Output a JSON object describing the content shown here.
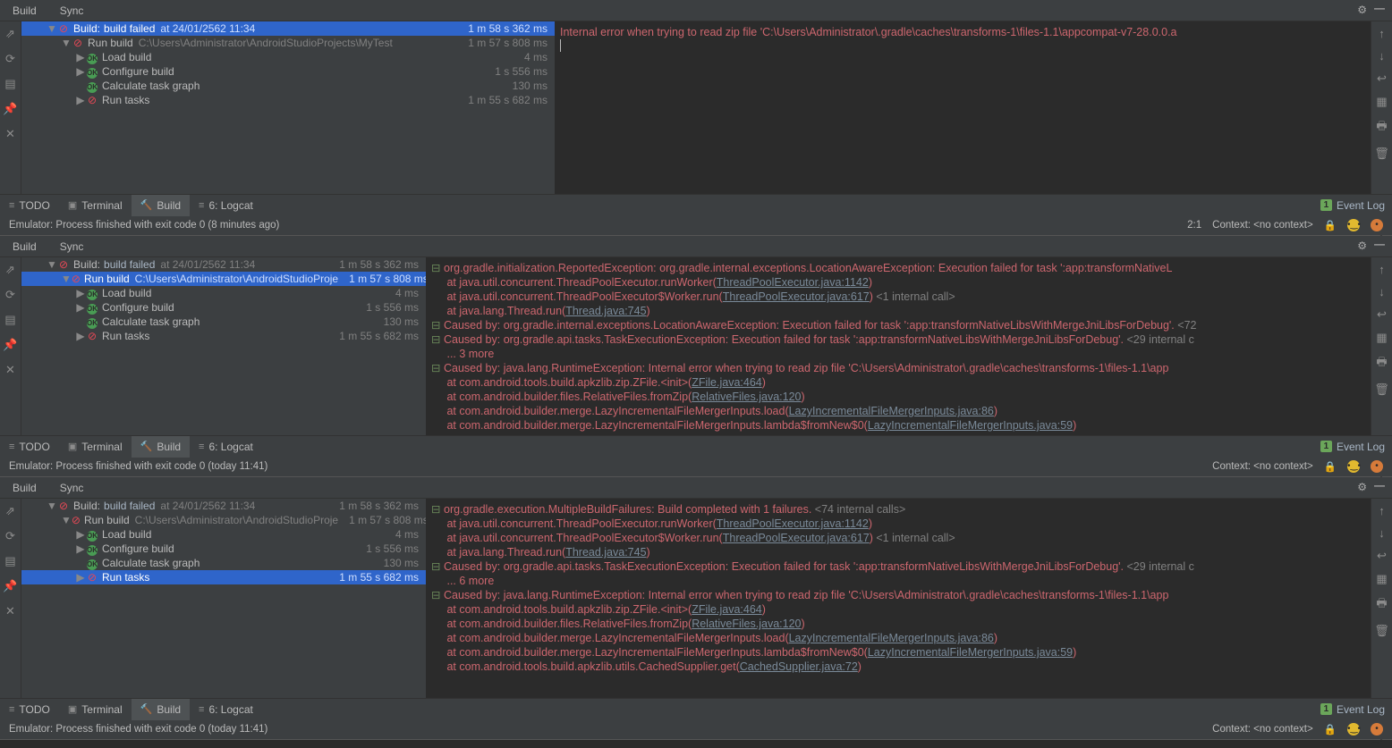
{
  "pane1": {
    "tabs": {
      "build": "Build",
      "sync": "Sync"
    },
    "tree": [
      {
        "indent": 28,
        "arrow": "▼",
        "ico": "err",
        "label": "Build:",
        "suffix": "build failed",
        "dim": "at 24/01/2562 11:34",
        "time": "1 m 58 s 362 ms",
        "sel": true
      },
      {
        "indent": 44,
        "arrow": "▼",
        "ico": "err",
        "label": "Run build",
        "dim": "C:\\Users\\Administrator\\AndroidStudioProjects\\MyTest",
        "time": "1 m 57 s 808 ms"
      },
      {
        "indent": 60,
        "arrow": "▶",
        "ico": "ok",
        "label": "Load build",
        "time": "4 ms"
      },
      {
        "indent": 60,
        "arrow": "▶",
        "ico": "ok",
        "label": "Configure build",
        "time": "1 s 556 ms"
      },
      {
        "indent": 60,
        "arrow": "",
        "ico": "ok",
        "label": "Calculate task graph",
        "time": "130 ms"
      },
      {
        "indent": 60,
        "arrow": "▶",
        "ico": "err",
        "label": "Run tasks",
        "time": "1 m 55 s 682 ms"
      }
    ],
    "treeWidth": 596,
    "console": [
      "Internal error when trying to read zip file 'C:\\Users\\Administrator\\.gradle\\caches\\transforms-1\\files-1.1\\appcompat-v7-28.0.0.a"
    ],
    "status": "Emulator: Process finished with exit code 0 (8 minutes ago)",
    "statusRight": [
      "2:1",
      "Context: <no context>"
    ]
  },
  "pane2": {
    "tabs": {
      "build": "Build",
      "sync": "Sync"
    },
    "tree": [
      {
        "indent": 28,
        "arrow": "▼",
        "ico": "err",
        "label": "Build:",
        "suffix": "build failed",
        "dim": "at 24/01/2562 11:34",
        "time": "1 m 58 s 362 ms"
      },
      {
        "indent": 44,
        "arrow": "▼",
        "ico": "err",
        "label": "Run build",
        "dim": "C:\\Users\\Administrator\\AndroidStudioProje",
        "time": "1 m 57 s 808 ms",
        "sel": true
      },
      {
        "indent": 60,
        "arrow": "▶",
        "ico": "ok",
        "label": "Load build",
        "time": "4 ms"
      },
      {
        "indent": 60,
        "arrow": "▶",
        "ico": "ok",
        "label": "Configure build",
        "time": "1 s 556 ms"
      },
      {
        "indent": 60,
        "arrow": "",
        "ico": "ok",
        "label": "Calculate task graph",
        "time": "130 ms"
      },
      {
        "indent": 60,
        "arrow": "▶",
        "ico": "err",
        "label": "Run tasks",
        "time": "1 m 55 s 682 ms"
      }
    ],
    "treeWidth": 452,
    "console": [
      {
        "fold": "⊟",
        "cls": "red-txt",
        "text": "org.gradle.initialization.ReportedException: org.gradle.internal.exceptions.LocationAwareException: Execution failed for task ':app:transformNativeL"
      },
      {
        "cls": "red-txt",
        "text": "      at java.util.concurrent.ThreadPoolExecutor.runWorker(",
        "link": "ThreadPoolExecutor.java:1142",
        "after": ")"
      },
      {
        "cls": "red-txt",
        "text": "      at java.util.concurrent.ThreadPoolExecutor$Worker.run(",
        "link": "ThreadPoolExecutor.java:617",
        "after": ") ",
        "gray": "<1 internal call>"
      },
      {
        "cls": "red-txt",
        "text": "      at java.lang.Thread.run(",
        "link": "Thread.java:745",
        "after": ")"
      },
      {
        "fold": "⊟",
        "cls": "red-txt",
        "text": "Caused by: org.gradle.internal.exceptions.LocationAwareException: Execution failed for task ':app:transformNativeLibsWithMergeJniLibsForDebug'. ",
        "gray": "<72"
      },
      {
        "fold": "⊟",
        "cls": "red-txt",
        "text": "Caused by: org.gradle.api.tasks.TaskExecutionException: Execution failed for task ':app:transformNativeLibsWithMergeJniLibsForDebug'. ",
        "gray": "<29 internal c"
      },
      {
        "cls": "red-txt",
        "text": "      ... 3 more"
      },
      {
        "fold": "⊟",
        "cls": "red-txt",
        "text": "Caused by: java.lang.RuntimeException: Internal error when trying to read zip file 'C:\\Users\\Administrator\\.gradle\\caches\\transforms-1\\files-1.1\\app"
      },
      {
        "cls": "red-txt",
        "text": "      at com.android.tools.build.apkzlib.zip.ZFile.<init>(",
        "link": "ZFile.java:464",
        "after": ")"
      },
      {
        "cls": "red-txt",
        "text": "      at com.android.builder.files.RelativeFiles.fromZip(",
        "link": "RelativeFiles.java:120",
        "after": ")"
      },
      {
        "cls": "red-txt",
        "text": "      at com.android.builder.merge.LazyIncrementalFileMergerInputs.load(",
        "link": "LazyIncrementalFileMergerInputs.java:86",
        "after": ")"
      },
      {
        "cls": "red-txt",
        "text": "      at com.android.builder.merge.LazyIncrementalFileMergerInputs.lambda$fromNew$0(",
        "link": "LazyIncrementalFileMergerInputs.java:59",
        "after": ")"
      }
    ],
    "status": "Emulator: Process finished with exit code 0 (today 11:41)",
    "statusRight": [
      "Context: <no context>"
    ]
  },
  "pane3": {
    "tabs": {
      "build": "Build",
      "sync": "Sync"
    },
    "tree": [
      {
        "indent": 28,
        "arrow": "▼",
        "ico": "err",
        "label": "Build:",
        "suffix": "build failed",
        "dim": "at 24/01/2562 11:34",
        "time": "1 m 58 s 362 ms"
      },
      {
        "indent": 44,
        "arrow": "▼",
        "ico": "err",
        "label": "Run build",
        "dim": "C:\\Users\\Administrator\\AndroidStudioProje",
        "time": "1 m 57 s 808 ms"
      },
      {
        "indent": 60,
        "arrow": "▶",
        "ico": "ok",
        "label": "Load build",
        "time": "4 ms"
      },
      {
        "indent": 60,
        "arrow": "▶",
        "ico": "ok",
        "label": "Configure build",
        "time": "1 s 556 ms"
      },
      {
        "indent": 60,
        "arrow": "",
        "ico": "ok",
        "label": "Calculate task graph",
        "time": "130 ms"
      },
      {
        "indent": 60,
        "arrow": "▶",
        "ico": "err",
        "label": "Run tasks",
        "time": "1 m 55 s 682 ms",
        "sel": true
      }
    ],
    "treeWidth": 452,
    "console": [
      {
        "fold": "⊟",
        "cls": "red-txt",
        "text": "org.gradle.execution.MultipleBuildFailures: Build completed with 1 failures. ",
        "gray": "<74 internal calls>"
      },
      {
        "cls": "red-txt",
        "text": "      at java.util.concurrent.ThreadPoolExecutor.runWorker(",
        "link": "ThreadPoolExecutor.java:1142",
        "after": ")"
      },
      {
        "cls": "red-txt",
        "text": "      at java.util.concurrent.ThreadPoolExecutor$Worker.run(",
        "link": "ThreadPoolExecutor.java:617",
        "after": ") ",
        "gray": "<1 internal call>"
      },
      {
        "cls": "red-txt",
        "text": "      at java.lang.Thread.run(",
        "link": "Thread.java:745",
        "after": ")"
      },
      {
        "fold": "⊟",
        "cls": "red-txt",
        "text": "Caused by: org.gradle.api.tasks.TaskExecutionException: Execution failed for task ':app:transformNativeLibsWithMergeJniLibsForDebug'. ",
        "gray": "<29 internal c"
      },
      {
        "cls": "red-txt",
        "text": "      ... 6 more"
      },
      {
        "fold": "⊟",
        "cls": "red-txt",
        "text": "Caused by: java.lang.RuntimeException: Internal error when trying to read zip file 'C:\\Users\\Administrator\\.gradle\\caches\\transforms-1\\files-1.1\\app"
      },
      {
        "cls": "red-txt",
        "text": "      at com.android.tools.build.apkzlib.zip.ZFile.<init>(",
        "link": "ZFile.java:464",
        "after": ")"
      },
      {
        "cls": "red-txt",
        "text": "      at com.android.builder.files.RelativeFiles.fromZip(",
        "link": "RelativeFiles.java:120",
        "after": ")"
      },
      {
        "cls": "red-txt",
        "text": "      at com.android.builder.merge.LazyIncrementalFileMergerInputs.load(",
        "link": "LazyIncrementalFileMergerInputs.java:86",
        "after": ")"
      },
      {
        "cls": "red-txt",
        "text": "      at com.android.builder.merge.LazyIncrementalFileMergerInputs.lambda$fromNew$0(",
        "link": "LazyIncrementalFileMergerInputs.java:59",
        "after": ")"
      },
      {
        "cls": "red-txt",
        "text": "      at com.android.tools.build.apkzlib.utils.CachedSupplier.get(",
        "link": "CachedSupplier.java:72",
        "after": ")"
      }
    ],
    "status": "Emulator: Process finished with exit code 0 (today 11:41)",
    "statusRight": [
      "Context: <no context>"
    ]
  },
  "bottomTabs": {
    "todo": "TODO",
    "terminal": "Terminal",
    "build": "Build",
    "logcat": "6: Logcat"
  },
  "eventLog": "Event Log",
  "eventBadge": "1"
}
